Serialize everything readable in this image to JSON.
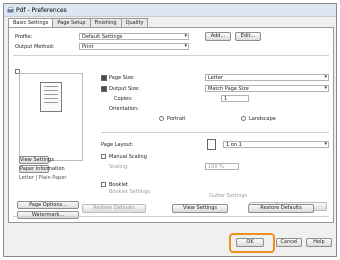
{
  "window": {
    "title": "Pdf - Preferences"
  },
  "tabs": [
    {
      "label": "Basic Settings"
    },
    {
      "label": "Page Setup"
    },
    {
      "label": "Finishing"
    },
    {
      "label": "Quality"
    }
  ],
  "top": {
    "profile_label": "Profile:",
    "profile_value": "Default Settings",
    "add_button": "Add...",
    "edit_button": "Edit...",
    "output_label": "Output Method:",
    "output_value": "Print"
  },
  "left": {
    "view_button": "View Settings",
    "paper_button": "Paper Information",
    "paper_info": "Letter | Plain Paper",
    "page_options_button": "Page Options...",
    "watermark_button": "Watermark..."
  },
  "right": {
    "page_size_label": "Page Size:",
    "page_size_value": "Letter",
    "output_size_label": "Output Size:",
    "output_size_value": "Match Page Size",
    "copies_label": "Copies:",
    "copies_value": "1",
    "orientation_label": "Orientation:",
    "portrait_label": "Portrait",
    "landscape_label": "Landscape",
    "page_layout_label": "Page Layout:",
    "page_layout_value": "1 on 1",
    "manual_scaling_label": "Manual Scaling",
    "scaling_label": "Scaling:",
    "scaling_value": "100 %",
    "booklet_label": "Booklet",
    "booklet_sub": "Booklet Settings",
    "staple_label": "Gutter Settings",
    "settings_button": "Settings..."
  },
  "bottom_bar": {
    "restore_button": "Restore Defaults",
    "view_button": "View Settings",
    "set_button": "Restore Defaults"
  },
  "footer": {
    "ok": "OK",
    "cancel": "Cancel",
    "help": "Help"
  },
  "colors": {
    "highlight": "#f0901c"
  }
}
